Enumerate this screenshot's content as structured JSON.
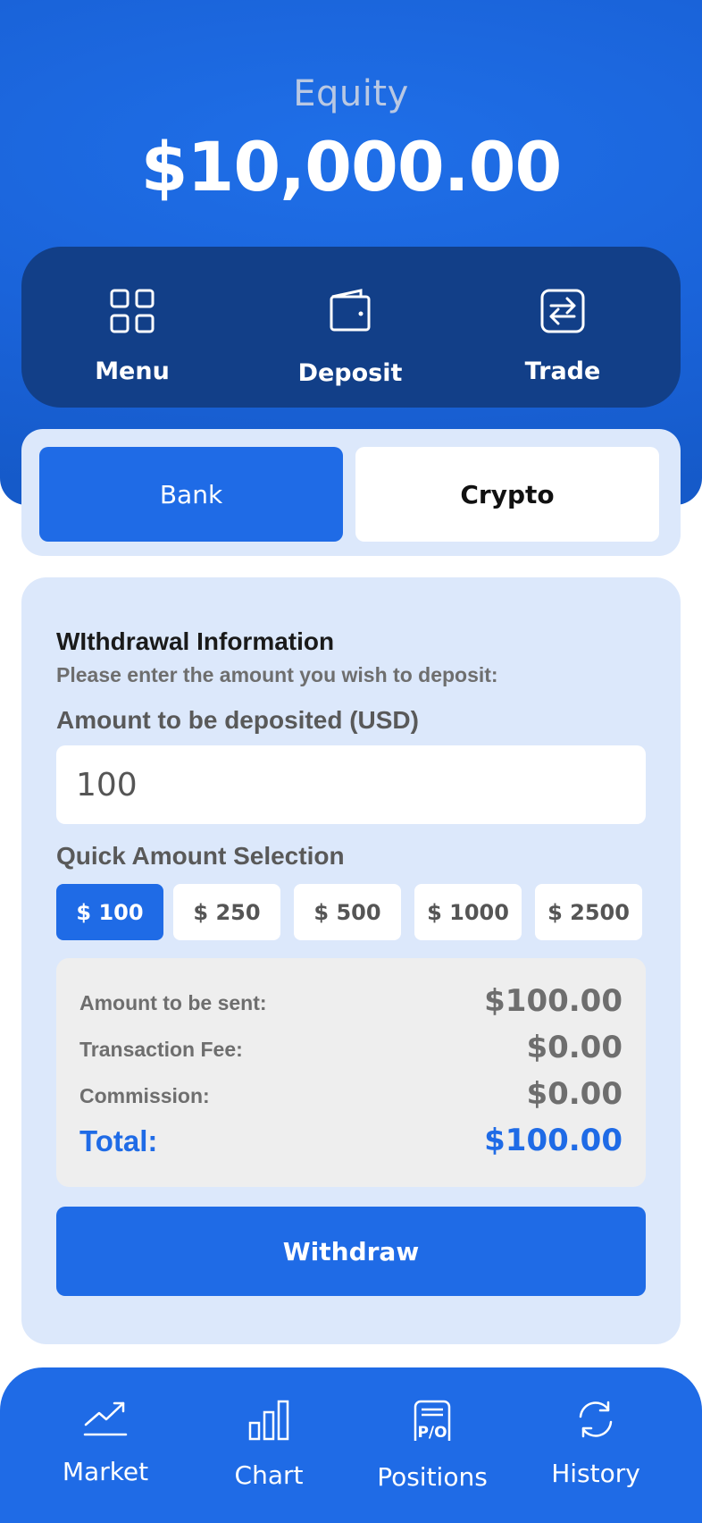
{
  "header": {
    "equity_label": "Equity",
    "equity_value": "$10,000.00"
  },
  "actions": {
    "menu": {
      "label": "Menu",
      "icon": "grid-icon"
    },
    "deposit": {
      "label": "Deposit",
      "icon": "wallet-icon"
    },
    "trade": {
      "label": "Trade",
      "icon": "exchange-icon"
    }
  },
  "method_toggle": {
    "bank": "Bank",
    "crypto": "Crypto",
    "selected": "Bank"
  },
  "form": {
    "title": "WIthdrawal Information",
    "subtitle": "Please enter the amount you wish to deposit:",
    "amount_label": "Amount to be deposited (USD)",
    "amount_value": "100",
    "quick_label": "Quick Amount Selection",
    "quick_amounts": [
      "$ 100",
      "$ 250",
      "$ 500",
      "$ 1000",
      "$ 2500"
    ],
    "quick_selected": "$ 100"
  },
  "summary": {
    "sent_label": "Amount to be sent:",
    "sent_value": "$100.00",
    "fee_label": "Transaction Fee:",
    "fee_value": "$0.00",
    "commission_label": "Commission:",
    "commission_value": "$0.00",
    "total_label": "Total:",
    "total_value": "$100.00"
  },
  "submit": {
    "label": "Withdraw"
  },
  "bottom_nav": {
    "market": {
      "label": "Market",
      "icon": "trend-up-icon"
    },
    "chart": {
      "label": "Chart",
      "icon": "bar-chart-icon"
    },
    "positions": {
      "label": "Positions",
      "icon": "receipt-pl-icon"
    },
    "history": {
      "label": "History",
      "icon": "refresh-icon"
    }
  },
  "colors": {
    "primary": "#1f6be6",
    "header_dark": "#123f88",
    "card_bg": "#dce8fb",
    "summary_bg": "#eeeeee"
  }
}
